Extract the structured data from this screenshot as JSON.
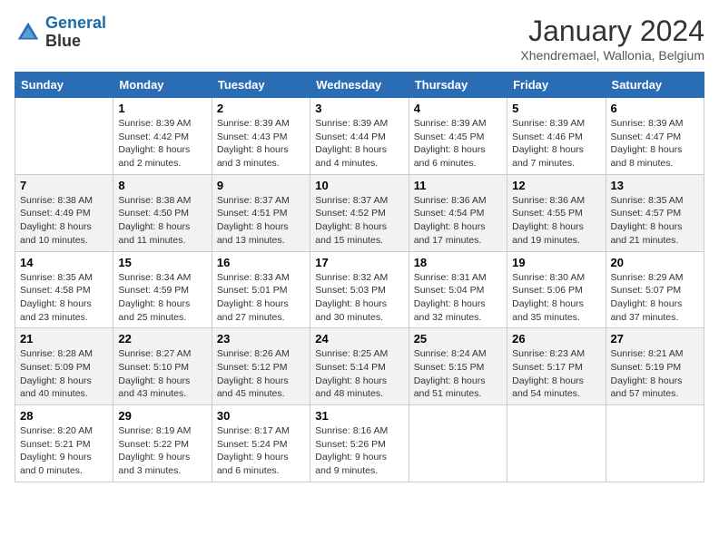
{
  "header": {
    "logo_line1": "General",
    "logo_line2": "Blue",
    "month": "January 2024",
    "location": "Xhendremael, Wallonia, Belgium"
  },
  "days_of_week": [
    "Sunday",
    "Monday",
    "Tuesday",
    "Wednesday",
    "Thursday",
    "Friday",
    "Saturday"
  ],
  "weeks": [
    [
      {
        "num": "",
        "detail": ""
      },
      {
        "num": "1",
        "detail": "Sunrise: 8:39 AM\nSunset: 4:42 PM\nDaylight: 8 hours\nand 2 minutes."
      },
      {
        "num": "2",
        "detail": "Sunrise: 8:39 AM\nSunset: 4:43 PM\nDaylight: 8 hours\nand 3 minutes."
      },
      {
        "num": "3",
        "detail": "Sunrise: 8:39 AM\nSunset: 4:44 PM\nDaylight: 8 hours\nand 4 minutes."
      },
      {
        "num": "4",
        "detail": "Sunrise: 8:39 AM\nSunset: 4:45 PM\nDaylight: 8 hours\nand 6 minutes."
      },
      {
        "num": "5",
        "detail": "Sunrise: 8:39 AM\nSunset: 4:46 PM\nDaylight: 8 hours\nand 7 minutes."
      },
      {
        "num": "6",
        "detail": "Sunrise: 8:39 AM\nSunset: 4:47 PM\nDaylight: 8 hours\nand 8 minutes."
      }
    ],
    [
      {
        "num": "7",
        "detail": "Sunrise: 8:38 AM\nSunset: 4:49 PM\nDaylight: 8 hours\nand 10 minutes."
      },
      {
        "num": "8",
        "detail": "Sunrise: 8:38 AM\nSunset: 4:50 PM\nDaylight: 8 hours\nand 11 minutes."
      },
      {
        "num": "9",
        "detail": "Sunrise: 8:37 AM\nSunset: 4:51 PM\nDaylight: 8 hours\nand 13 minutes."
      },
      {
        "num": "10",
        "detail": "Sunrise: 8:37 AM\nSunset: 4:52 PM\nDaylight: 8 hours\nand 15 minutes."
      },
      {
        "num": "11",
        "detail": "Sunrise: 8:36 AM\nSunset: 4:54 PM\nDaylight: 8 hours\nand 17 minutes."
      },
      {
        "num": "12",
        "detail": "Sunrise: 8:36 AM\nSunset: 4:55 PM\nDaylight: 8 hours\nand 19 minutes."
      },
      {
        "num": "13",
        "detail": "Sunrise: 8:35 AM\nSunset: 4:57 PM\nDaylight: 8 hours\nand 21 minutes."
      }
    ],
    [
      {
        "num": "14",
        "detail": "Sunrise: 8:35 AM\nSunset: 4:58 PM\nDaylight: 8 hours\nand 23 minutes."
      },
      {
        "num": "15",
        "detail": "Sunrise: 8:34 AM\nSunset: 4:59 PM\nDaylight: 8 hours\nand 25 minutes."
      },
      {
        "num": "16",
        "detail": "Sunrise: 8:33 AM\nSunset: 5:01 PM\nDaylight: 8 hours\nand 27 minutes."
      },
      {
        "num": "17",
        "detail": "Sunrise: 8:32 AM\nSunset: 5:03 PM\nDaylight: 8 hours\nand 30 minutes."
      },
      {
        "num": "18",
        "detail": "Sunrise: 8:31 AM\nSunset: 5:04 PM\nDaylight: 8 hours\nand 32 minutes."
      },
      {
        "num": "19",
        "detail": "Sunrise: 8:30 AM\nSunset: 5:06 PM\nDaylight: 8 hours\nand 35 minutes."
      },
      {
        "num": "20",
        "detail": "Sunrise: 8:29 AM\nSunset: 5:07 PM\nDaylight: 8 hours\nand 37 minutes."
      }
    ],
    [
      {
        "num": "21",
        "detail": "Sunrise: 8:28 AM\nSunset: 5:09 PM\nDaylight: 8 hours\nand 40 minutes."
      },
      {
        "num": "22",
        "detail": "Sunrise: 8:27 AM\nSunset: 5:10 PM\nDaylight: 8 hours\nand 43 minutes."
      },
      {
        "num": "23",
        "detail": "Sunrise: 8:26 AM\nSunset: 5:12 PM\nDaylight: 8 hours\nand 45 minutes."
      },
      {
        "num": "24",
        "detail": "Sunrise: 8:25 AM\nSunset: 5:14 PM\nDaylight: 8 hours\nand 48 minutes."
      },
      {
        "num": "25",
        "detail": "Sunrise: 8:24 AM\nSunset: 5:15 PM\nDaylight: 8 hours\nand 51 minutes."
      },
      {
        "num": "26",
        "detail": "Sunrise: 8:23 AM\nSunset: 5:17 PM\nDaylight: 8 hours\nand 54 minutes."
      },
      {
        "num": "27",
        "detail": "Sunrise: 8:21 AM\nSunset: 5:19 PM\nDaylight: 8 hours\nand 57 minutes."
      }
    ],
    [
      {
        "num": "28",
        "detail": "Sunrise: 8:20 AM\nSunset: 5:21 PM\nDaylight: 9 hours\nand 0 minutes."
      },
      {
        "num": "29",
        "detail": "Sunrise: 8:19 AM\nSunset: 5:22 PM\nDaylight: 9 hours\nand 3 minutes."
      },
      {
        "num": "30",
        "detail": "Sunrise: 8:17 AM\nSunset: 5:24 PM\nDaylight: 9 hours\nand 6 minutes."
      },
      {
        "num": "31",
        "detail": "Sunrise: 8:16 AM\nSunset: 5:26 PM\nDaylight: 9 hours\nand 9 minutes."
      },
      {
        "num": "",
        "detail": ""
      },
      {
        "num": "",
        "detail": ""
      },
      {
        "num": "",
        "detail": ""
      }
    ]
  ]
}
